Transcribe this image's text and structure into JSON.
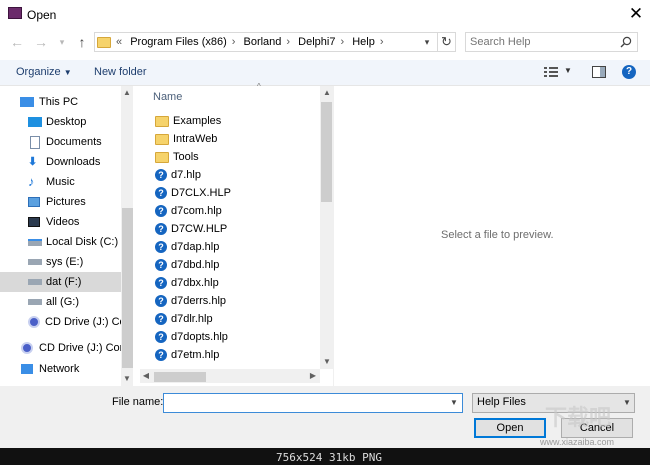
{
  "window": {
    "title": "Open"
  },
  "breadcrumb": {
    "overflow": "«",
    "items": [
      "Program Files (x86)",
      "Borland",
      "Delphi7",
      "Help"
    ]
  },
  "search": {
    "placeholder": "Search Help"
  },
  "toolbar": {
    "organize": "Organize",
    "new_folder": "New folder"
  },
  "nav": {
    "items": [
      {
        "label": "This PC",
        "icon": "pc-icon",
        "indent": 0,
        "selected": false
      },
      {
        "label": "Desktop",
        "icon": "desktop-icon",
        "indent": 1,
        "selected": false
      },
      {
        "label": "Documents",
        "icon": "documents-icon",
        "indent": 1,
        "selected": false
      },
      {
        "label": "Downloads",
        "icon": "downloads-icon",
        "indent": 1,
        "selected": false
      },
      {
        "label": "Music",
        "icon": "music-icon",
        "indent": 1,
        "selected": false
      },
      {
        "label": "Pictures",
        "icon": "pictures-icon",
        "indent": 1,
        "selected": false
      },
      {
        "label": "Videos",
        "icon": "videos-icon",
        "indent": 1,
        "selected": false
      },
      {
        "label": "Local Disk (C:)",
        "icon": "drive-icon",
        "indent": 1,
        "selected": false
      },
      {
        "label": "sys (E:)",
        "icon": "drive-icon",
        "indent": 1,
        "selected": false
      },
      {
        "label": "dat (F:)",
        "icon": "drive-icon",
        "indent": 1,
        "selected": true
      },
      {
        "label": "all (G:)",
        "icon": "drive-icon",
        "indent": 1,
        "selected": false
      },
      {
        "label": "CD Drive (J:) Cor",
        "icon": "cd-drive-icon",
        "indent": 1,
        "selected": false
      },
      {
        "label": "CD Drive (J:) Conn",
        "icon": "cd-drive-icon",
        "indent": 0,
        "selected": false
      },
      {
        "label": "Network",
        "icon": "network-icon",
        "indent": 0,
        "selected": false
      }
    ]
  },
  "files": {
    "column_name": "Name",
    "items": [
      {
        "name": "Examples",
        "type": "folder"
      },
      {
        "name": "IntraWeb",
        "type": "folder"
      },
      {
        "name": "Tools",
        "type": "folder"
      },
      {
        "name": "d7.hlp",
        "type": "help"
      },
      {
        "name": "D7CLX.HLP",
        "type": "help"
      },
      {
        "name": "d7com.hlp",
        "type": "help"
      },
      {
        "name": "D7CW.HLP",
        "type": "help"
      },
      {
        "name": "d7dap.hlp",
        "type": "help"
      },
      {
        "name": "d7dbd.hlp",
        "type": "help"
      },
      {
        "name": "d7dbx.hlp",
        "type": "help"
      },
      {
        "name": "d7derrs.hlp",
        "type": "help"
      },
      {
        "name": "d7dlr.hlp",
        "type": "help"
      },
      {
        "name": "d7dopts.hlp",
        "type": "help"
      },
      {
        "name": "d7etm.hlp",
        "type": "help"
      }
    ]
  },
  "preview": {
    "text": "Select a file to preview."
  },
  "bottom": {
    "filename_label": "File name:",
    "filename_value": "",
    "filetype": "Help Files",
    "open_label": "Open",
    "cancel_label": "Cancel"
  },
  "status": {
    "text": "756x524  31kb  PNG"
  },
  "watermark": {
    "text": "下载吧",
    "url": "www.xiazaiba.com"
  },
  "colors": {
    "accent": "#0078d7",
    "selection": "#d9d9d9",
    "help_icon": "#1565c0",
    "folder": "#f6d36b"
  }
}
